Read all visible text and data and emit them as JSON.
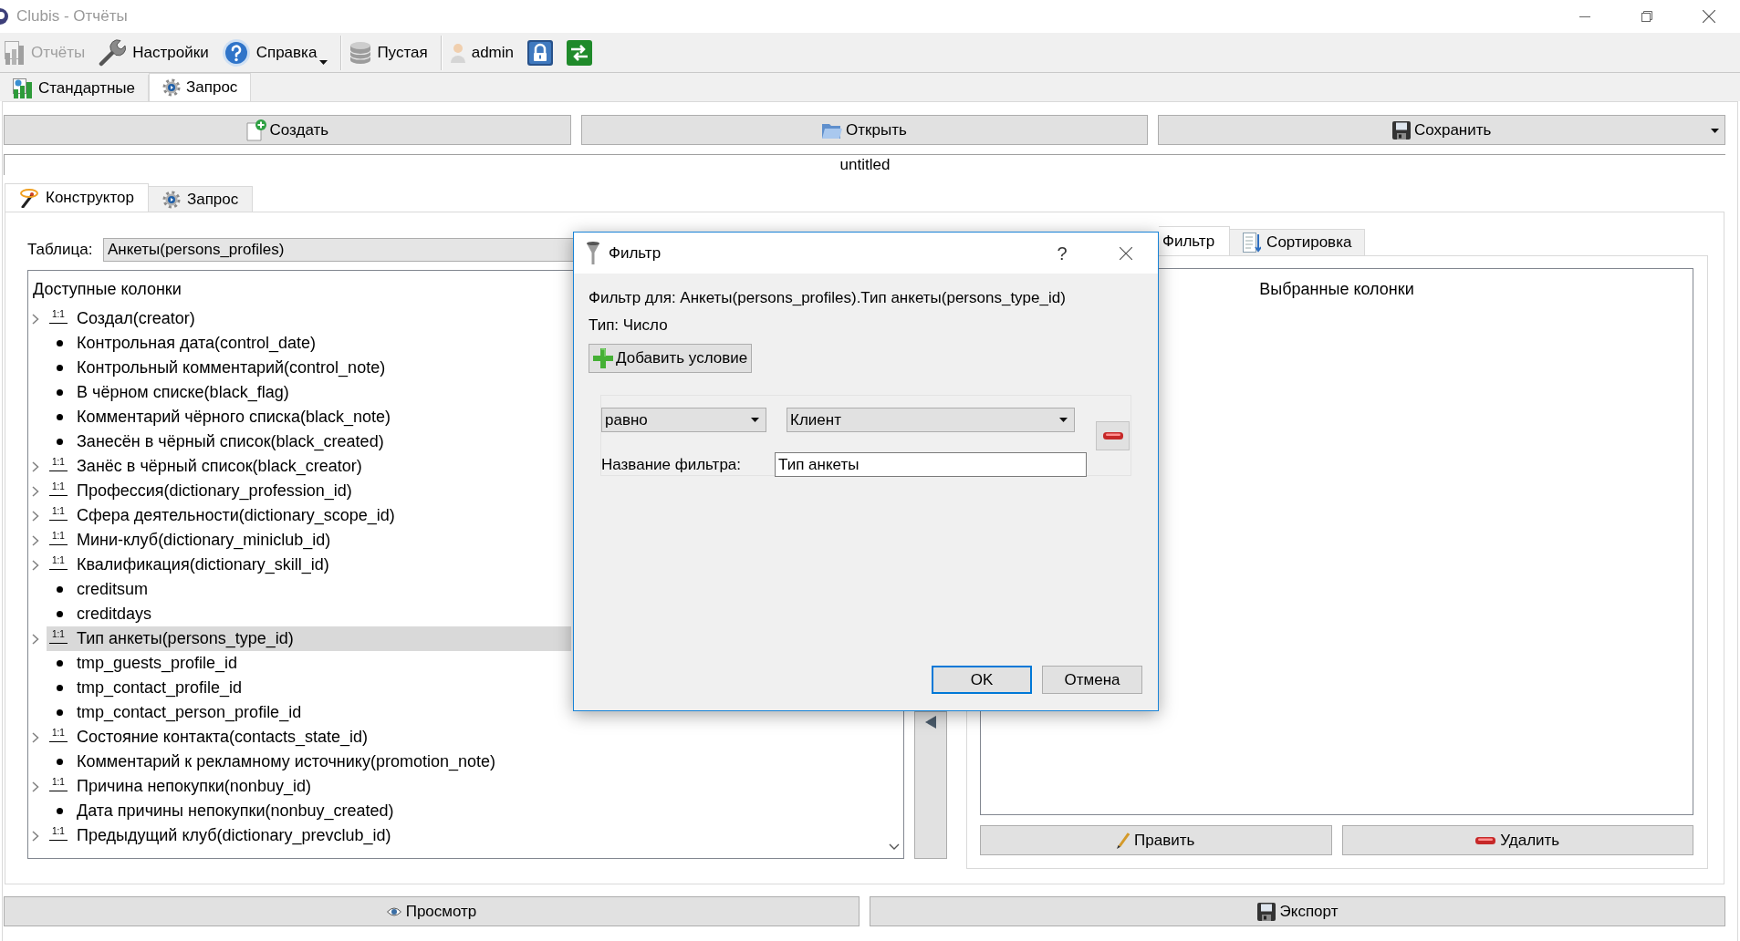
{
  "window": {
    "title": "Clubis - Отчёты"
  },
  "toolbar": [
    {
      "kind": "button",
      "label": "Отчёты",
      "disabled": true,
      "menu": false
    },
    {
      "kind": "button",
      "label": "Настройки",
      "disabled": false,
      "menu": false
    },
    {
      "kind": "button",
      "label": "Справка",
      "disabled": false,
      "menu": true
    },
    {
      "kind": "separator"
    },
    {
      "kind": "button",
      "label": "Пустая",
      "disabled": false,
      "menu": false
    },
    {
      "kind": "separator"
    },
    {
      "kind": "button",
      "label": "admin",
      "disabled": false,
      "menu": false
    },
    {
      "kind": "icon_button",
      "disabled": false,
      "menu": false
    },
    {
      "kind": "icon_button",
      "disabled": false,
      "menu": false
    }
  ],
  "tabs": [
    {
      "label": "Стандартные",
      "selected": false
    },
    {
      "label": "Запрос",
      "selected": true
    }
  ],
  "actions": [
    {
      "label": "Создать",
      "menu": false
    },
    {
      "label": "Открыть",
      "menu": false
    },
    {
      "label": "Сохранить",
      "menu": true
    }
  ],
  "query_name": "untitled",
  "editor_tabs": [
    {
      "label": "Конструктор",
      "selected": true
    },
    {
      "label": "Запрос",
      "selected": false
    }
  ],
  "table": {
    "label": "Таблица:",
    "value": "Анкеты(persons_profiles)"
  },
  "available_columns": {
    "title": "Доступные колонки",
    "items": [
      {
        "kind": "relation",
        "cardinality": "1:1",
        "label": "Создал(creator)",
        "expanded": false,
        "selected": false
      },
      {
        "kind": "field",
        "label": "Контрольная дата(control_date)",
        "selected": false
      },
      {
        "kind": "field",
        "label": "Контрольный комментарий(control_note)",
        "selected": false
      },
      {
        "kind": "field",
        "label": "В чёрном списке(black_flag)",
        "selected": false
      },
      {
        "kind": "field",
        "label": "Комментарий чёрного списка(black_note)",
        "selected": false
      },
      {
        "kind": "field",
        "label": "Занесён в чёрный список(black_created)",
        "selected": false
      },
      {
        "kind": "relation",
        "cardinality": "1:1",
        "label": "Занёс в чёрный список(black_creator)",
        "expanded": false,
        "selected": false
      },
      {
        "kind": "relation",
        "cardinality": "1:1",
        "label": "Профессия(dictionary_profession_id)",
        "expanded": false,
        "selected": false
      },
      {
        "kind": "relation",
        "cardinality": "1:1",
        "label": "Сфера деятельности(dictionary_scope_id)",
        "expanded": false,
        "selected": false
      },
      {
        "kind": "relation",
        "cardinality": "1:1",
        "label": "Мини-клуб(dictionary_miniclub_id)",
        "expanded": false,
        "selected": false
      },
      {
        "kind": "relation",
        "cardinality": "1:1",
        "label": "Квалификация(dictionary_skill_id)",
        "expanded": false,
        "selected": false
      },
      {
        "kind": "field",
        "label": "creditsum",
        "selected": false
      },
      {
        "kind": "field",
        "label": "creditdays",
        "selected": false
      },
      {
        "kind": "relation",
        "cardinality": "1:1",
        "label": "Тип анкеты(persons_type_id)",
        "expanded": false,
        "selected": true
      },
      {
        "kind": "field",
        "label": "tmp_guests_profile_id",
        "selected": false
      },
      {
        "kind": "field",
        "label": "tmp_contact_profile_id",
        "selected": false
      },
      {
        "kind": "field",
        "label": "tmp_contact_person_profile_id",
        "selected": false
      },
      {
        "kind": "relation",
        "cardinality": "1:1",
        "label": "Состояние контакта(contacts_state_id)",
        "expanded": false,
        "selected": false
      },
      {
        "kind": "field",
        "label": "Комментарий к рекламному источнику(promotion_note)",
        "selected": false
      },
      {
        "kind": "relation",
        "cardinality": "1:1",
        "label": "Причина непокупки(nonbuy_id)",
        "expanded": false,
        "selected": false
      },
      {
        "kind": "field",
        "label": "Дата причины непокупки(nonbuy_created)",
        "selected": false
      },
      {
        "kind": "relation",
        "cardinality": "1:1",
        "label": "Предыдущий клуб(dictionary_prevclub_id)",
        "expanded": false,
        "selected": false
      }
    ]
  },
  "selection_tabs": [
    {
      "label": "Фильтр",
      "selected": true
    },
    {
      "label": "Сортировка",
      "selected": false
    }
  ],
  "selected_columns": {
    "title": "Выбранные колонки"
  },
  "list_actions": [
    "Править",
    "Удалить"
  ],
  "footer_actions": [
    "Просмотр",
    "Экспорт"
  ],
  "dialog": {
    "title": "Фильтр",
    "help": "?",
    "target": "Фильтр для: Анкеты(persons_profiles).Тип анкеты(persons_type_id)",
    "type": "Тип: Число",
    "add_button": "Добавить условие",
    "conditions": [
      {
        "operator": "равно",
        "value": "Клиент",
        "name_label": "Название фильтра:",
        "name_value": "Тип анкеты"
      }
    ],
    "buttons": [
      {
        "label": "OK",
        "default": true
      },
      {
        "label": "Отмена",
        "default": false
      }
    ]
  }
}
